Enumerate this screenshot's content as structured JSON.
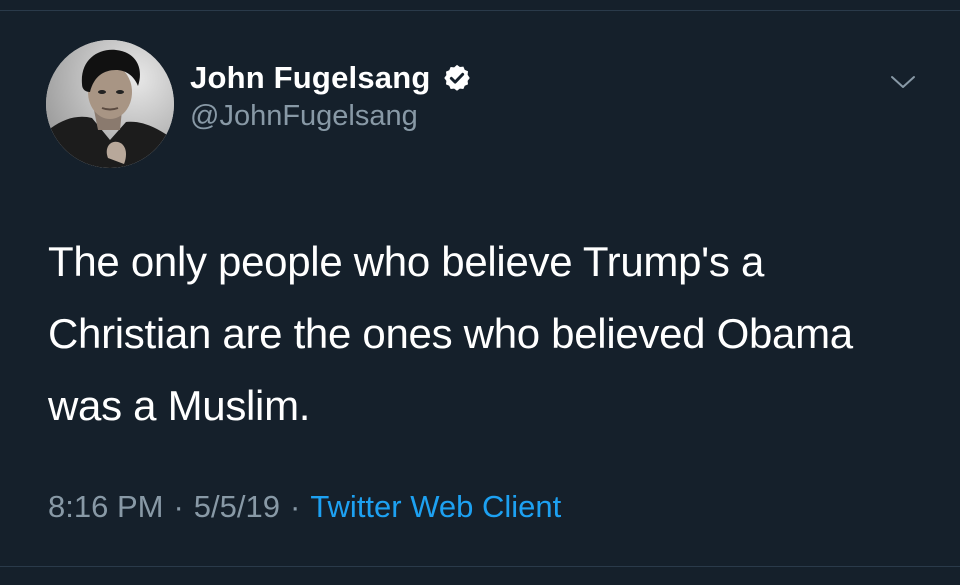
{
  "tweet": {
    "author": {
      "display_name": "John Fugelsang",
      "handle": "@JohnFugelsang",
      "verified": true
    },
    "body": "The only people who believe Trump's a Christian are the ones who believed Obama was a Muslim.",
    "meta": {
      "time": "8:16 PM",
      "separator": "·",
      "date": "5/5/19",
      "source": "Twitter Web Client"
    }
  },
  "colors": {
    "background": "#15202b",
    "text_primary": "#ffffff",
    "text_secondary": "#8899a6",
    "link": "#1da1f2"
  },
  "icons": {
    "verified": "verified-badge-icon",
    "menu": "chevron-down-icon"
  }
}
